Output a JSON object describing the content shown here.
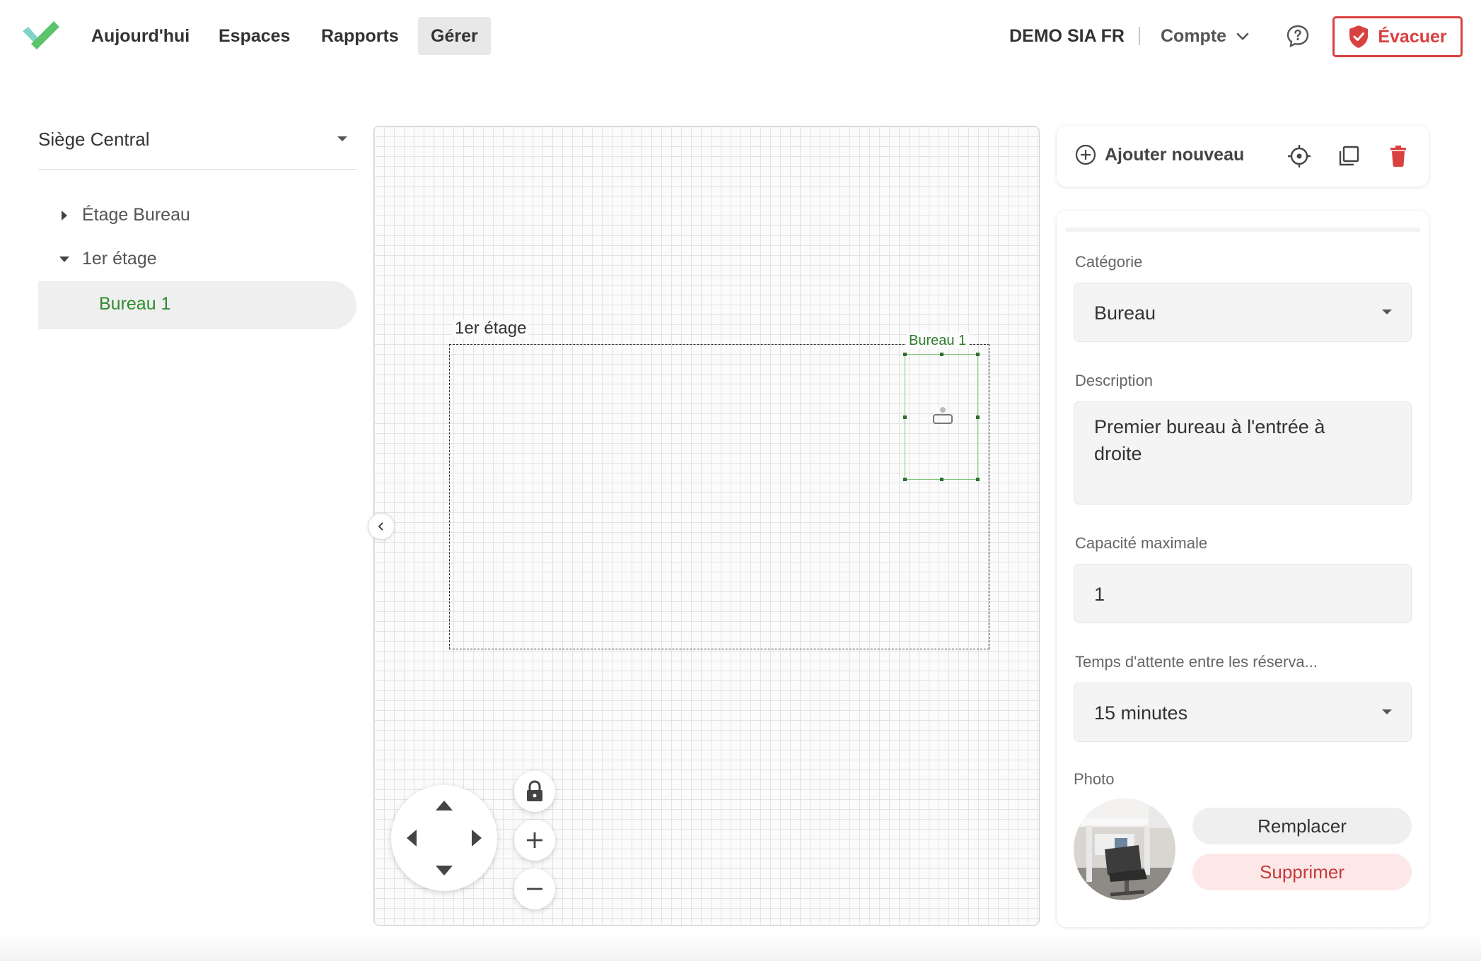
{
  "nav": {
    "links": [
      "Aujourd'hui",
      "Espaces",
      "Rapports",
      "Gérer"
    ],
    "active": "Gérer",
    "org_name": "DEMO SIA FR",
    "account_label": "Compte",
    "evacuate_label": "Évacuer"
  },
  "sidebar": {
    "site": "Siège Central",
    "tree": [
      {
        "label": "Étage Bureau",
        "expanded": false
      },
      {
        "label": "1er étage",
        "expanded": true
      },
      {
        "label": "Bureau 1",
        "selected": true
      }
    ]
  },
  "canvas": {
    "floor_label": "1er étage",
    "room_label": "Bureau 1"
  },
  "toolbar": {
    "add_new_label": "Ajouter nouveau"
  },
  "properties": {
    "category_label": "Catégorie",
    "category_value": "Bureau",
    "description_label": "Description",
    "description_value": "Premier bureau à l'entrée à droite",
    "capacity_label": "Capacité maximale",
    "capacity_value": "1",
    "wait_label": "Temps d'attente entre les réserva...",
    "wait_value": "15 minutes",
    "photo_label": "Photo",
    "replace_label": "Remplacer",
    "delete_label": "Supprimer"
  },
  "colors": {
    "accent_green": "#2e8b2e",
    "danger_red": "#d94040"
  }
}
